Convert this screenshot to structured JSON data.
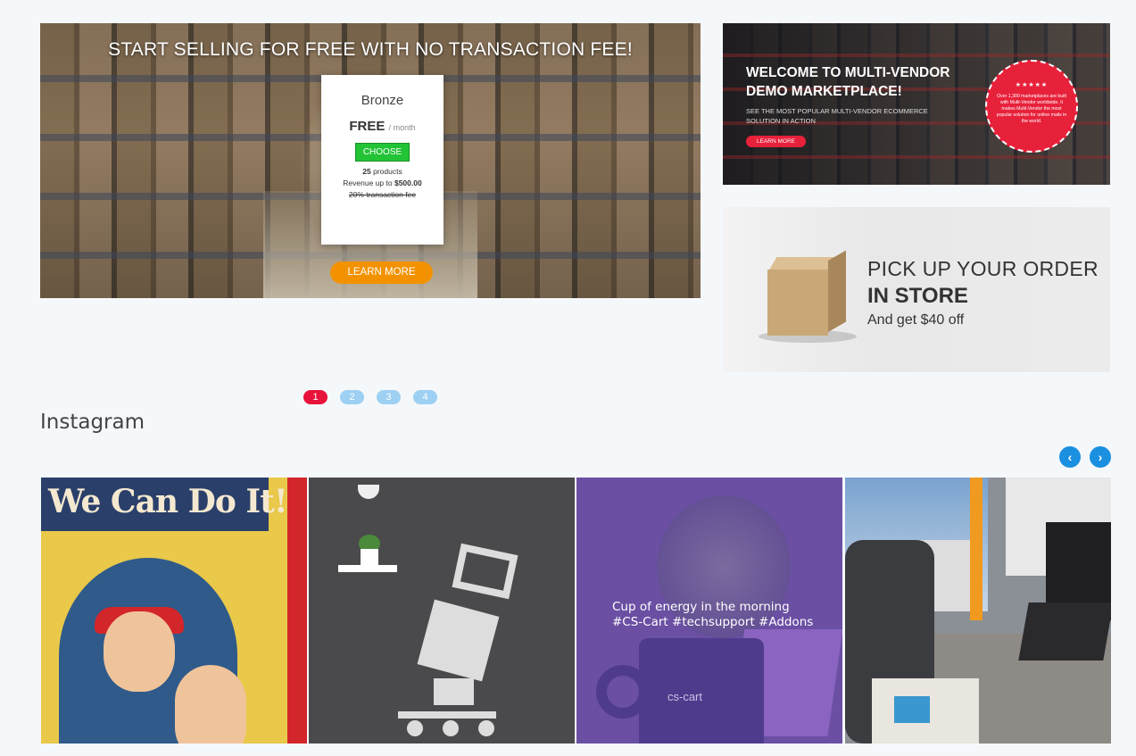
{
  "hero": {
    "headline": "START SELLING FOR FREE WITH NO TRANSACTION FEE!",
    "plan": {
      "name": "Bronze",
      "price": "FREE",
      "period": "/ month",
      "choose_label": "CHOOSE",
      "feature_products_count": "25",
      "feature_products_text": "products",
      "feature_revenue_text": "Revenue up to",
      "feature_revenue_value": "$500.00",
      "feature_fee_text": "20% transaction fee"
    },
    "learn_more_label": "LEARN MORE"
  },
  "welcome_banner": {
    "title": "WELCOME TO MULTI-VENDOR DEMO MARKETPLACE!",
    "subtitle": "SEE THE MOST POPULAR MULTI-VENDOR ECOMMERCE SOLUTION IN ACTION",
    "learn_more_label": "LEARN MORE",
    "badge_stars": "★★★★★",
    "badge_text": "Over 1,300 marketplaces are built with Multi-Vendor worldwide. It makes Multi-Vendor the most popular solution for online mails in the world."
  },
  "pickup_banner": {
    "line1": "PICK UP YOUR ORDER",
    "line2": "IN STORE",
    "line3": "And get $40 off"
  },
  "pager": {
    "pages": [
      "1",
      "2",
      "3",
      "4"
    ],
    "active": "1"
  },
  "instagram": {
    "title": "Instagram",
    "prev_icon": "chevron-left-icon",
    "next_icon": "chevron-right-icon",
    "prev_glyph": "‹",
    "next_glyph": "›",
    "tile1_text": "We Can Do It!",
    "tile3_caption_line1": "Cup of energy in the morning",
    "tile3_caption_line2": "#CS-Cart #techsupport #Addons",
    "tile3_brand": "cs-cart"
  },
  "colors": {
    "accent_red": "#e8133a",
    "pager_inactive": "#9dd0f2",
    "nav_blue": "#1b8fe0",
    "cta_orange": "#f39200",
    "choose_green": "#22c335"
  }
}
